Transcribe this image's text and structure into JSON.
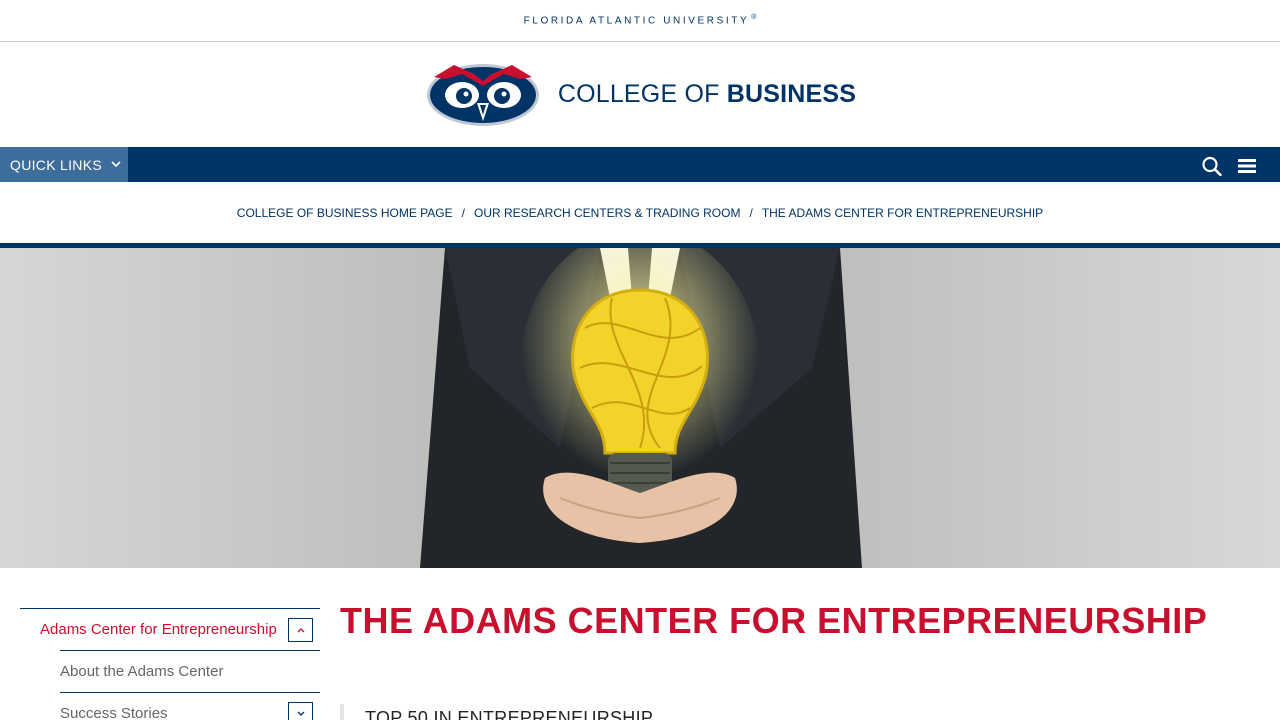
{
  "topbar": {
    "university": "FLORIDA ATLANTIC UNIVERSITY",
    "reg_mark": "®"
  },
  "brand": {
    "title_light": "COLLEGE OF ",
    "title_bold": "BUSINESS"
  },
  "navbar": {
    "quick_links_label": "QUICK LINKS"
  },
  "breadcrumb": {
    "items": [
      "COLLEGE OF BUSINESS HOME PAGE",
      "OUR RESEARCH CENTERS & TRADING ROOM",
      "THE ADAMS CENTER FOR ENTREPRENEURSHIP"
    ],
    "separator": "/"
  },
  "sidebar": {
    "items": [
      {
        "label": "Adams Center for Entrepreneurship",
        "expanded": true
      },
      {
        "label": "About the Adams Center"
      },
      {
        "label": "Success Stories",
        "expanded": false
      }
    ]
  },
  "main": {
    "title": "THE ADAMS CENTER FOR ENTREPRENEURSHIP",
    "subheading": "TOP 50 IN ENTREPRENEURSHIP"
  },
  "colors": {
    "navy": "#003366",
    "accent_red": "#c8102e",
    "quick_links_bg": "#3d6d9a"
  }
}
